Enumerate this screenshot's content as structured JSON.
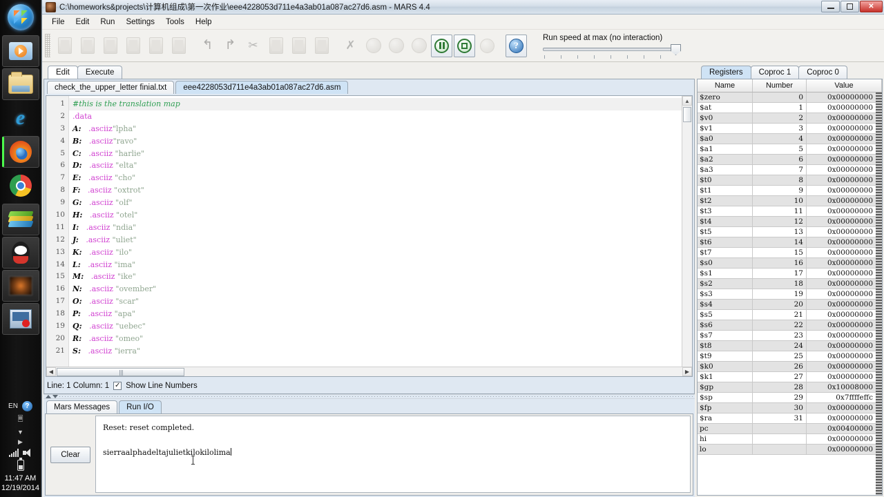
{
  "taskbar": {
    "items": [
      {
        "name": "start-orb",
        "label": "Start"
      },
      {
        "name": "windows-media-player-icon",
        "label": "Windows Media Player"
      },
      {
        "name": "file-explorer-icon",
        "label": "File Explorer"
      },
      {
        "name": "internet-explorer-icon",
        "label": "Internet Explorer"
      },
      {
        "name": "firefox-icon",
        "label": "Mozilla Firefox"
      },
      {
        "name": "chrome-icon",
        "label": "Google Chrome"
      },
      {
        "name": "bluestacks-icon",
        "label": "BlueStacks"
      },
      {
        "name": "qq-icon",
        "label": "QQ"
      },
      {
        "name": "blurred-app-icon",
        "label": "Application"
      },
      {
        "name": "screen-recorder-icon",
        "label": "Screen Recorder"
      }
    ],
    "tray": {
      "language": "EN",
      "help_icon": "?",
      "time": "11:47 AM",
      "date": "12/19/2014"
    }
  },
  "window": {
    "title": "C:\\homeworks&projects\\计算机组成\\第一次作业\\eee4228053d711e4a3ab01a087ac27d6.asm  - MARS 4.4",
    "buttons": {
      "minimize": "",
      "maximize": "",
      "close": "✕"
    }
  },
  "menu": [
    "File",
    "Edit",
    "Run",
    "Settings",
    "Tools",
    "Help"
  ],
  "toolbar": {
    "speed_label": "Run speed at max (no interaction)",
    "buttons": [
      {
        "name": "new-file-button",
        "state": "disabled"
      },
      {
        "name": "open-file-button",
        "state": "disabled"
      },
      {
        "name": "save-file-button",
        "state": "disabled"
      },
      {
        "name": "save-as-button",
        "state": "disabled"
      },
      {
        "name": "dump-memory-button",
        "state": "disabled"
      },
      {
        "name": "print-button",
        "state": "disabled"
      },
      {
        "name": "undo-button",
        "state": "disabled"
      },
      {
        "name": "redo-button",
        "state": "disabled"
      },
      {
        "name": "cut-button",
        "state": "disabled"
      },
      {
        "name": "copy-button",
        "state": "disabled"
      },
      {
        "name": "paste-button",
        "state": "disabled"
      },
      {
        "name": "find-replace-button",
        "state": "disabled"
      },
      {
        "name": "assemble-button",
        "state": "disabled"
      },
      {
        "name": "run-button",
        "state": "disabled"
      },
      {
        "name": "step-button",
        "state": "disabled"
      },
      {
        "name": "backstep-button",
        "state": "disabled"
      },
      {
        "name": "pause-button",
        "state": "enabled"
      },
      {
        "name": "stop-button",
        "state": "enabled"
      },
      {
        "name": "reset-button",
        "state": "disabled"
      },
      {
        "name": "help-button",
        "state": "enabled"
      }
    ]
  },
  "main_tabs": [
    {
      "label": "Edit",
      "selected": true
    },
    {
      "label": "Execute",
      "selected": false
    }
  ],
  "file_tabs": [
    {
      "label": "check_the_upper_letter finial.txt",
      "active": false
    },
    {
      "label": "eee4228053d711e4a3ab01a087ac27d6.asm",
      "active": true
    }
  ],
  "editor": {
    "lines": [
      {
        "num": "1",
        "segments": [
          {
            "t": "#this is the translation map",
            "c": "c-comment"
          }
        ]
      },
      {
        "num": "2",
        "segments": [
          {
            "t": ".data",
            "c": "c-dir"
          }
        ]
      },
      {
        "num": "3",
        "segments": [
          {
            "t": "A:",
            "c": "c-label"
          },
          {
            "t": "   ",
            "c": ""
          },
          {
            "t": ".asciiz",
            "c": "c-dir"
          },
          {
            "t": "\"lpha\"",
            "c": "c-str"
          }
        ]
      },
      {
        "num": "4",
        "segments": [
          {
            "t": "B:",
            "c": "c-label"
          },
          {
            "t": "   ",
            "c": ""
          },
          {
            "t": ".asciiz",
            "c": "c-dir"
          },
          {
            "t": "\"ravo\"",
            "c": "c-str"
          }
        ]
      },
      {
        "num": "5",
        "segments": [
          {
            "t": "C:",
            "c": "c-label"
          },
          {
            "t": "   ",
            "c": ""
          },
          {
            "t": ".asciiz",
            "c": "c-dir"
          },
          {
            "t": " \"harlie\"",
            "c": "c-str"
          }
        ]
      },
      {
        "num": "6",
        "segments": [
          {
            "t": "D:",
            "c": "c-label"
          },
          {
            "t": "   ",
            "c": ""
          },
          {
            "t": ".asciiz",
            "c": "c-dir"
          },
          {
            "t": " \"elta\"",
            "c": "c-str"
          }
        ]
      },
      {
        "num": "7",
        "segments": [
          {
            "t": "E:",
            "c": "c-label"
          },
          {
            "t": "   ",
            "c": ""
          },
          {
            "t": ".asciiz",
            "c": "c-dir"
          },
          {
            "t": " \"cho\"",
            "c": "c-str"
          }
        ]
      },
      {
        "num": "8",
        "segments": [
          {
            "t": "F:",
            "c": "c-label"
          },
          {
            "t": "   ",
            "c": ""
          },
          {
            "t": ".asciiz",
            "c": "c-dir"
          },
          {
            "t": " \"oxtrot\"",
            "c": "c-str"
          }
        ]
      },
      {
        "num": "9",
        "segments": [
          {
            "t": "G:",
            "c": "c-label"
          },
          {
            "t": "   ",
            "c": ""
          },
          {
            "t": ".asciiz",
            "c": "c-dir"
          },
          {
            "t": " \"olf\"",
            "c": "c-str"
          }
        ]
      },
      {
        "num": "10",
        "segments": [
          {
            "t": "H:",
            "c": "c-label"
          },
          {
            "t": "   ",
            "c": ""
          },
          {
            "t": ".asciiz",
            "c": "c-dir"
          },
          {
            "t": " \"otel\"",
            "c": "c-str"
          }
        ]
      },
      {
        "num": "11",
        "segments": [
          {
            "t": "I:",
            "c": "c-label"
          },
          {
            "t": "   ",
            "c": ""
          },
          {
            "t": ".asciiz",
            "c": "c-dir"
          },
          {
            "t": " \"ndia\"",
            "c": "c-str"
          }
        ]
      },
      {
        "num": "12",
        "segments": [
          {
            "t": "J:",
            "c": "c-label"
          },
          {
            "t": "   ",
            "c": ""
          },
          {
            "t": ".asciiz",
            "c": "c-dir"
          },
          {
            "t": " \"uliet\"",
            "c": "c-str"
          }
        ]
      },
      {
        "num": "13",
        "segments": [
          {
            "t": "K:",
            "c": "c-label"
          },
          {
            "t": "   ",
            "c": ""
          },
          {
            "t": ".asciiz",
            "c": "c-dir"
          },
          {
            "t": " \"ilo\"",
            "c": "c-str"
          }
        ]
      },
      {
        "num": "14",
        "segments": [
          {
            "t": "L:",
            "c": "c-label"
          },
          {
            "t": "   ",
            "c": ""
          },
          {
            "t": ".asciiz",
            "c": "c-dir"
          },
          {
            "t": " \"ima\"",
            "c": "c-str"
          }
        ]
      },
      {
        "num": "15",
        "segments": [
          {
            "t": "M:",
            "c": "c-label"
          },
          {
            "t": "   ",
            "c": ""
          },
          {
            "t": ".asciiz",
            "c": "c-dir"
          },
          {
            "t": " \"ike\"",
            "c": "c-str"
          }
        ]
      },
      {
        "num": "16",
        "segments": [
          {
            "t": "N:",
            "c": "c-label"
          },
          {
            "t": "   ",
            "c": ""
          },
          {
            "t": ".asciiz",
            "c": "c-dir"
          },
          {
            "t": " \"ovember\"",
            "c": "c-str"
          }
        ]
      },
      {
        "num": "17",
        "segments": [
          {
            "t": "O:",
            "c": "c-label"
          },
          {
            "t": "   ",
            "c": ""
          },
          {
            "t": ".asciiz",
            "c": "c-dir"
          },
          {
            "t": " \"scar\"",
            "c": "c-str"
          }
        ]
      },
      {
        "num": "18",
        "segments": [
          {
            "t": "P:",
            "c": "c-label"
          },
          {
            "t": "   ",
            "c": ""
          },
          {
            "t": ".asciiz",
            "c": "c-dir"
          },
          {
            "t": " \"apa\"",
            "c": "c-str"
          }
        ]
      },
      {
        "num": "19",
        "segments": [
          {
            "t": "Q:",
            "c": "c-label"
          },
          {
            "t": "   ",
            "c": ""
          },
          {
            "t": ".asciiz",
            "c": "c-dir"
          },
          {
            "t": " \"uebec\"",
            "c": "c-str"
          }
        ]
      },
      {
        "num": "20",
        "segments": [
          {
            "t": "R:",
            "c": "c-label"
          },
          {
            "t": "   ",
            "c": ""
          },
          {
            "t": ".asciiz",
            "c": "c-dir"
          },
          {
            "t": " \"omeo\"",
            "c": "c-str"
          }
        ]
      },
      {
        "num": "21",
        "segments": [
          {
            "t": "S:",
            "c": "c-label"
          },
          {
            "t": "   ",
            "c": ""
          },
          {
            "t": ".asciiz",
            "c": "c-dir"
          },
          {
            "t": " \"ierra\"",
            "c": "c-str"
          }
        ]
      }
    ]
  },
  "status": {
    "position": "Line: 1 Column: 1",
    "show_line_numbers_label": "Show Line Numbers",
    "show_line_numbers_checked": true
  },
  "message_tabs": [
    {
      "label": "Mars Messages",
      "active": false
    },
    {
      "label": "Run I/O",
      "active": true
    }
  ],
  "messages": {
    "clear_label": "Clear",
    "lines": [
      "Reset: reset completed.",
      "",
      "sierraalphadeltajulietkilokilolima"
    ]
  },
  "registers": {
    "tabs": [
      {
        "label": "Registers",
        "active": true
      },
      {
        "label": "Coproc 1",
        "active": false
      },
      {
        "label": "Coproc 0",
        "active": false
      }
    ],
    "columns": [
      "Name",
      "Number",
      "Value"
    ],
    "rows": [
      {
        "name": "$zero",
        "number": "0",
        "value": "0x00000000"
      },
      {
        "name": "$at",
        "number": "1",
        "value": "0x00000000"
      },
      {
        "name": "$v0",
        "number": "2",
        "value": "0x00000000"
      },
      {
        "name": "$v1",
        "number": "3",
        "value": "0x00000000"
      },
      {
        "name": "$a0",
        "number": "4",
        "value": "0x00000000"
      },
      {
        "name": "$a1",
        "number": "5",
        "value": "0x00000000"
      },
      {
        "name": "$a2",
        "number": "6",
        "value": "0x00000000"
      },
      {
        "name": "$a3",
        "number": "7",
        "value": "0x00000000"
      },
      {
        "name": "$t0",
        "number": "8",
        "value": "0x00000000"
      },
      {
        "name": "$t1",
        "number": "9",
        "value": "0x00000000"
      },
      {
        "name": "$t2",
        "number": "10",
        "value": "0x00000000"
      },
      {
        "name": "$t3",
        "number": "11",
        "value": "0x00000000"
      },
      {
        "name": "$t4",
        "number": "12",
        "value": "0x00000000"
      },
      {
        "name": "$t5",
        "number": "13",
        "value": "0x00000000"
      },
      {
        "name": "$t6",
        "number": "14",
        "value": "0x00000000"
      },
      {
        "name": "$t7",
        "number": "15",
        "value": "0x00000000"
      },
      {
        "name": "$s0",
        "number": "16",
        "value": "0x00000000"
      },
      {
        "name": "$s1",
        "number": "17",
        "value": "0x00000000"
      },
      {
        "name": "$s2",
        "number": "18",
        "value": "0x00000000"
      },
      {
        "name": "$s3",
        "number": "19",
        "value": "0x00000000"
      },
      {
        "name": "$s4",
        "number": "20",
        "value": "0x00000000"
      },
      {
        "name": "$s5",
        "number": "21",
        "value": "0x00000000"
      },
      {
        "name": "$s6",
        "number": "22",
        "value": "0x00000000"
      },
      {
        "name": "$s7",
        "number": "23",
        "value": "0x00000000"
      },
      {
        "name": "$t8",
        "number": "24",
        "value": "0x00000000"
      },
      {
        "name": "$t9",
        "number": "25",
        "value": "0x00000000"
      },
      {
        "name": "$k0",
        "number": "26",
        "value": "0x00000000"
      },
      {
        "name": "$k1",
        "number": "27",
        "value": "0x00000000"
      },
      {
        "name": "$gp",
        "number": "28",
        "value": "0x10008000"
      },
      {
        "name": "$sp",
        "number": "29",
        "value": "0x7ffffeffc"
      },
      {
        "name": "$fp",
        "number": "30",
        "value": "0x00000000"
      },
      {
        "name": "$ra",
        "number": "31",
        "value": "0x00000000"
      },
      {
        "name": "pc",
        "number": "",
        "value": "0x00400000"
      },
      {
        "name": "hi",
        "number": "",
        "value": "0x00000000"
      },
      {
        "name": "lo",
        "number": "",
        "value": "0x00000000"
      }
    ]
  }
}
